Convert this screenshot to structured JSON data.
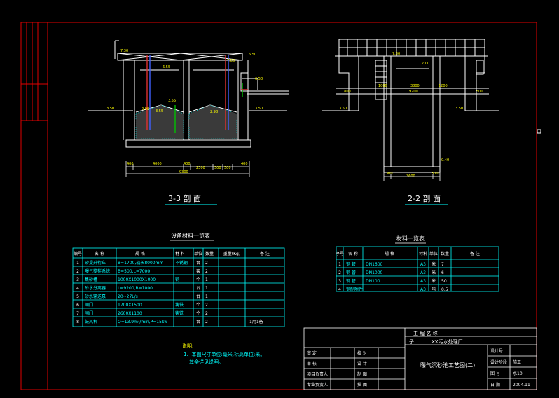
{
  "sections": {
    "left_title": "3-3 剖 面",
    "right_title": "2-2 剖 面"
  },
  "dims_left": {
    "levels": [
      "7.30",
      "6.55",
      "3.55",
      "3.50",
      "3.50",
      "2.98",
      "2.98",
      "3.55",
      "7.00",
      "6.50",
      "3.50",
      "6.50"
    ],
    "bottom": [
      "400",
      "4000",
      "400",
      "2300",
      "500",
      "500",
      "400",
      "9300"
    ]
  },
  "dims_right": {
    "levels": [
      "7.30",
      "7.00",
      "3.50",
      "3.50",
      "0.40"
    ],
    "spans": [
      "1000",
      "3800",
      "1200",
      "9200",
      "1800",
      "500"
    ],
    "bottom": [
      "300",
      "3600",
      "300"
    ]
  },
  "equip_table": {
    "title": "设备材料一览表",
    "headers": [
      "编号",
      "名 称",
      "规 格",
      "材 料",
      "单位",
      "数量",
      "重量(Kg)",
      "备 注"
    ],
    "rows": [
      {
        "no": "1",
        "name": "砂提升桁车",
        "spec": "B=1700,轨长8000mm",
        "mat": "不锈钢",
        "unit": "台",
        "qty": "2",
        "w": "",
        "rem": ""
      },
      {
        "no": "2",
        "name": "曝气搅拌系统",
        "spec": "B=500,L=7000",
        "mat": "",
        "unit": "套",
        "qty": "2",
        "w": "",
        "rem": ""
      },
      {
        "no": "3",
        "name": "集砂槽",
        "spec": "1000X1000X1000",
        "mat": "钢",
        "unit": "个",
        "qty": "1",
        "w": "",
        "rem": ""
      },
      {
        "no": "4",
        "name": "砂水分离器",
        "spec": "L=9200,B=1000",
        "mat": "",
        "unit": "台",
        "qty": "1",
        "w": "",
        "rem": ""
      },
      {
        "no": "5",
        "name": "砂水输送泵",
        "spec": "20~27L/s",
        "mat": "",
        "unit": "台",
        "qty": "1",
        "w": "",
        "rem": ""
      },
      {
        "no": "6",
        "name": "闸门",
        "spec": "1700X1500",
        "mat": "铸铁",
        "unit": "个",
        "qty": "2",
        "w": "",
        "rem": ""
      },
      {
        "no": "7",
        "name": "闸门",
        "spec": "2600X1100",
        "mat": "铸铁",
        "unit": "个",
        "qty": "2",
        "w": "",
        "rem": ""
      },
      {
        "no": "8",
        "name": "鼓风机",
        "spec": "Q=13.9m³/min,P=15kw",
        "mat": "",
        "unit": "台",
        "qty": "2",
        "w": "",
        "rem": "1用1备"
      }
    ]
  },
  "mat_table": {
    "title": "材料一览表",
    "headers": [
      "序号",
      "名 称",
      "规 格",
      "材料",
      "单位",
      "数量",
      "备 注"
    ],
    "rows": [
      {
        "no": "1",
        "name": "钢 管",
        "spec": "DN1600",
        "mat": "A3",
        "unit": "米",
        "qty": "7",
        "rem": ""
      },
      {
        "no": "2",
        "name": "钢 管",
        "spec": "DN1000",
        "mat": "A3",
        "unit": "米",
        "qty": "6",
        "rem": ""
      },
      {
        "no": "3",
        "name": "钢 管",
        "spec": "DN100",
        "mat": "A3",
        "unit": "米",
        "qty": "50",
        "rem": ""
      },
      {
        "no": "4",
        "name": "钢制附件",
        "spec": "",
        "mat": "A3",
        "unit": "吨",
        "qty": "0.5",
        "rem": ""
      }
    ]
  },
  "notes": {
    "title": "说明:",
    "line1": "1、本图尺寸单位:毫米,标高单位:米。",
    "line2": "其余详见说明。"
  },
  "title_block": {
    "project_label": "工 程 名 称",
    "sub_label": "子",
    "project_name": "XX污水处理厂",
    "left_rows": [
      {
        "a": "审 定",
        "b": "校 对"
      },
      {
        "a": "审 核",
        "b": "设 计"
      },
      {
        "a": "项目负责人",
        "b": "制 图"
      },
      {
        "a": "专业负责人",
        "b": "描 图"
      }
    ],
    "drawing_name": "曝气沉砂池工艺图(二)",
    "right_rows": [
      {
        "k": "设计号",
        "v": ""
      },
      {
        "k": "设计阶段",
        "v": "施工"
      },
      {
        "k": "图 号",
        "v": "水10"
      },
      {
        "k": "日 期",
        "v": "2004.11"
      }
    ]
  }
}
